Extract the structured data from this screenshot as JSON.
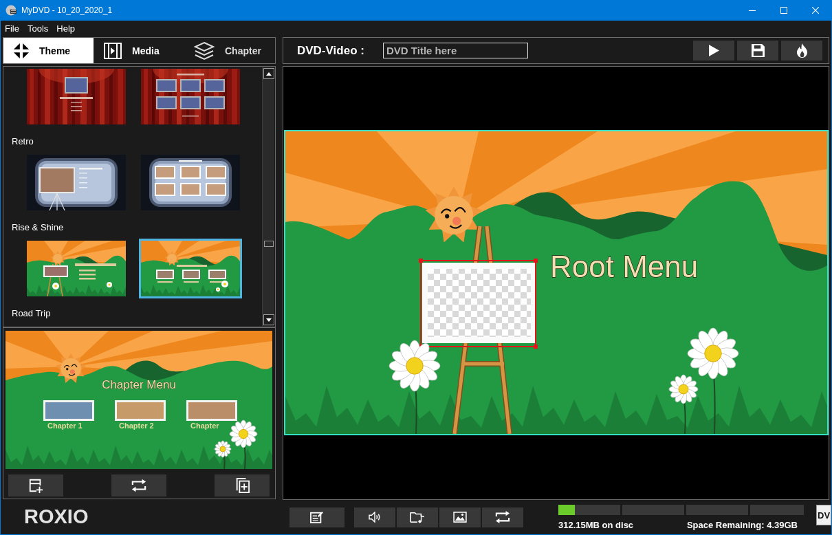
{
  "window": {
    "title": "MyDVD - 10_20_2020_1"
  },
  "menu": [
    "File",
    "Tools",
    "Help"
  ],
  "tabs": [
    {
      "label": "Theme",
      "selected": true
    },
    {
      "label": "Media",
      "selected": false
    },
    {
      "label": "Chapter",
      "selected": false
    }
  ],
  "themes": [
    {
      "kind": "curtain",
      "thumbnails": [
        {
          "kind": "main",
          "selected": false
        },
        {
          "kind": "chapters",
          "selected": false
        }
      ]
    },
    {
      "name": "Retro",
      "kind": "projector",
      "thumbnails": [
        {
          "kind": "main",
          "selected": false
        },
        {
          "kind": "chapters",
          "selected": false
        }
      ]
    },
    {
      "name": "Rise & Shine",
      "kind": "meadow",
      "thumbnails": [
        {
          "kind": "main",
          "selected": false
        },
        {
          "kind": "chapters",
          "selected": true
        }
      ]
    },
    {
      "name": "Road Trip"
    }
  ],
  "chapter_preview": {
    "title": "Chapter Menu",
    "chapters": [
      {
        "label": "Chapter 1"
      },
      {
        "label": "Chapter 2"
      },
      {
        "label": "Chapter"
      }
    ]
  },
  "logo": "ROXIO",
  "project": {
    "label": "DVD-Video :",
    "title_field": {
      "placeholder": "DVD Title here"
    }
  },
  "menu_preview": {
    "title": "Root Menu",
    "image_selected": true
  },
  "disc": {
    "level": 0.066,
    "used": "312.15MB on disc",
    "remaining": "Space Remaining: 4.39GB",
    "format": "DV"
  }
}
